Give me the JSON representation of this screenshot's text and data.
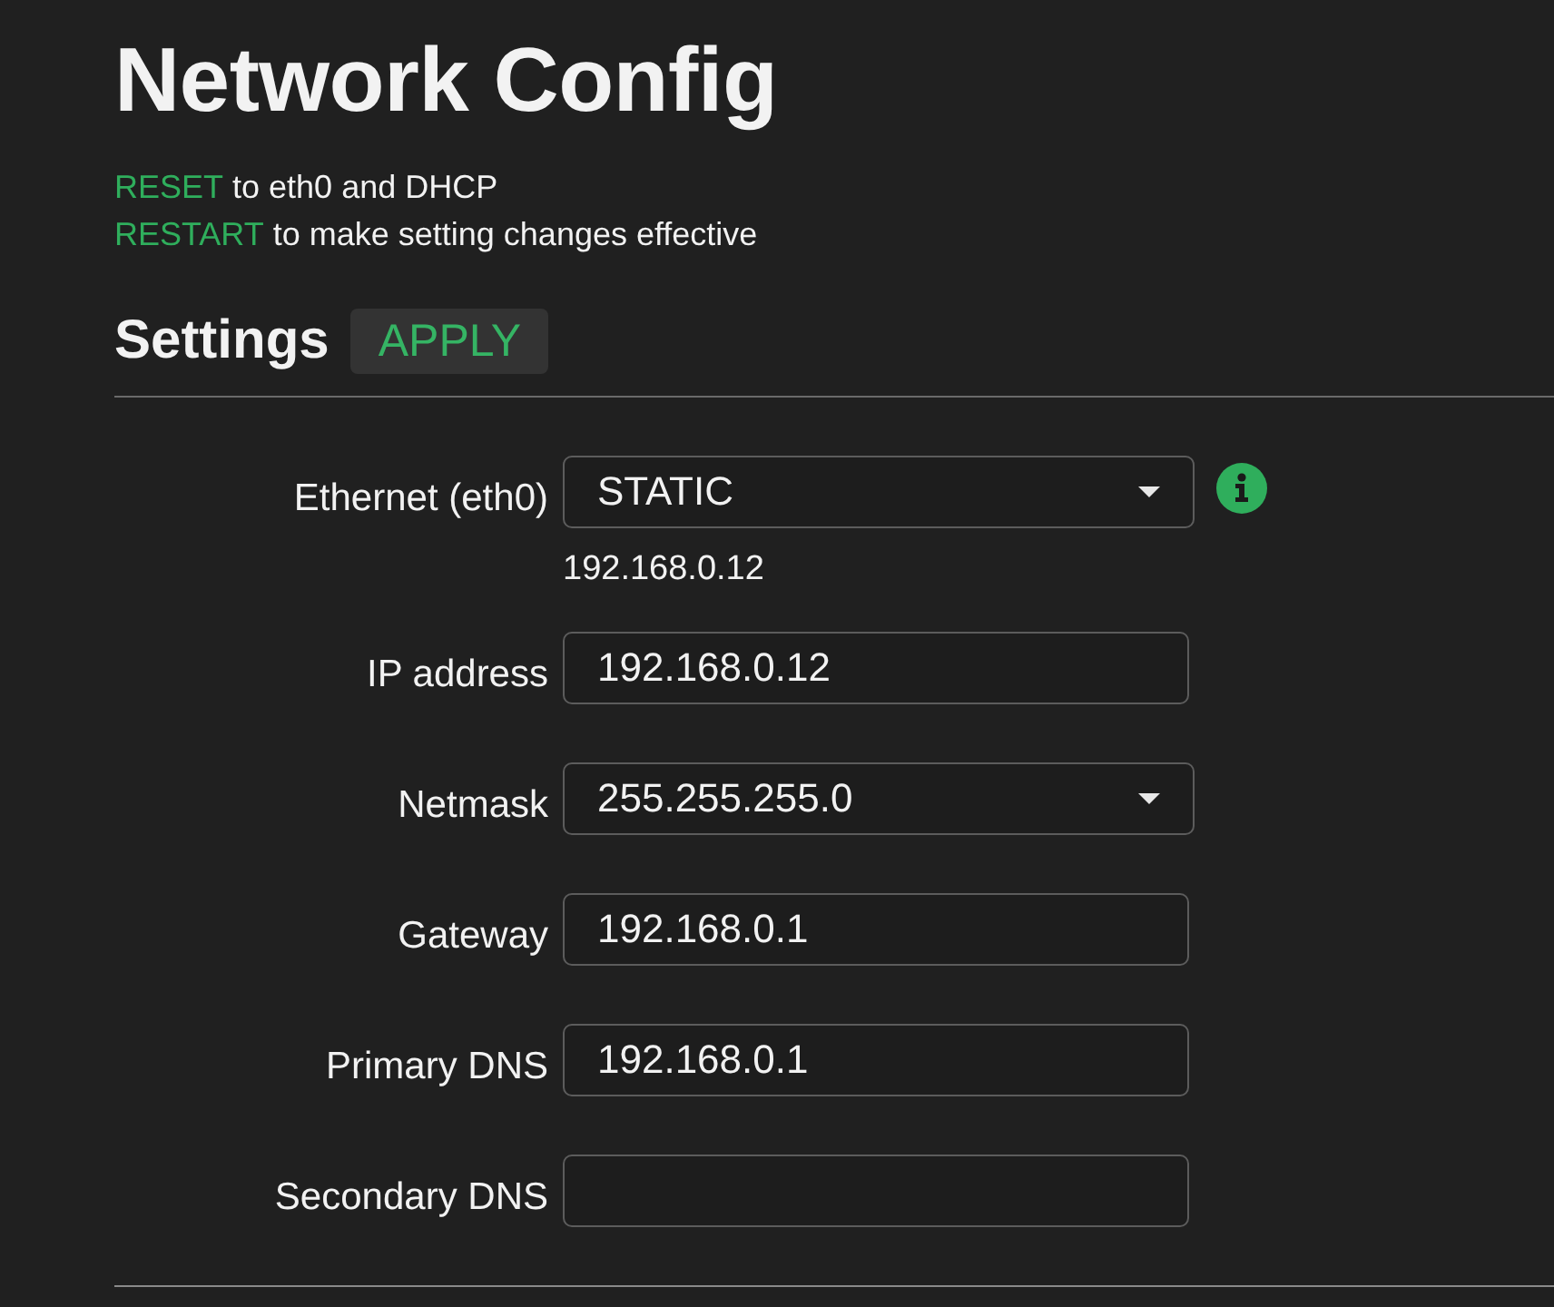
{
  "title": "Network Config",
  "notes": [
    {
      "action": "RESET",
      "text": "to eth0 and DHCP"
    },
    {
      "action": "RESTART",
      "text": "to make setting changes effective"
    }
  ],
  "settings": {
    "heading": "Settings",
    "apply_button": "APPLY"
  },
  "fields": [
    {
      "kind": "select",
      "label": "Ethernet (eth0)",
      "value": "STATIC",
      "info": true,
      "hint": "192.168.0.12"
    },
    {
      "kind": "text",
      "label": "IP address",
      "value": "192.168.0.12"
    },
    {
      "kind": "select",
      "label": "Netmask",
      "value": "255.255.255.0"
    },
    {
      "kind": "text",
      "label": "Gateway",
      "value": "192.168.0.1"
    },
    {
      "kind": "text",
      "label": "Primary DNS",
      "value": "192.168.0.1"
    },
    {
      "kind": "text",
      "label": "Secondary DNS"
    }
  ]
}
